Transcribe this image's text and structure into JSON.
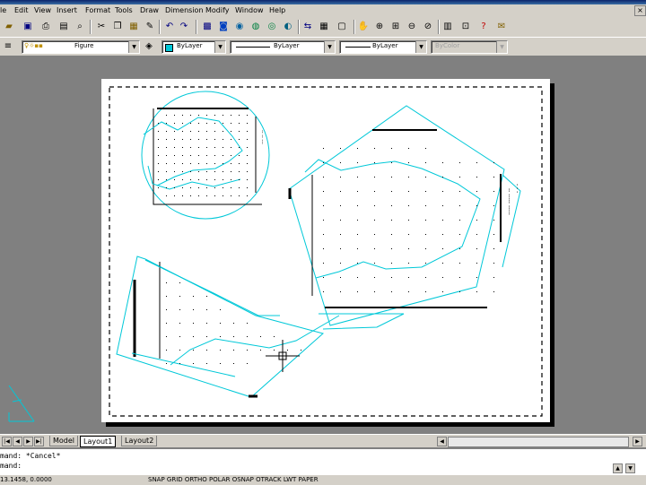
{
  "menu": [
    "le",
    "Edit",
    "View",
    "Insert",
    "Format",
    "Tools",
    "Draw",
    "Dimension",
    "Modify",
    "Window",
    "Help"
  ],
  "toolbar2": {
    "layer_value": "Figure",
    "color_value": "ByLayer",
    "linetype_value": "ByLayer",
    "lineweight_value": "ByLayer",
    "plotstyle_value": "ByColor"
  },
  "tabs": {
    "model": "Model",
    "layout1": "Layout1",
    "layout2": "Layout2"
  },
  "command": {
    "line1": "mand: *Cancel*",
    "line2": "mand:"
  },
  "status": {
    "coords": "13.1458, 0.0000",
    "toggles": "SNAP GRID ORTHO POLAR OSNAP OTRACK LWT PAPER"
  },
  "colors": {
    "viewport_lines": "#00c8d8",
    "background": "#808080",
    "paper": "#ffffff"
  }
}
